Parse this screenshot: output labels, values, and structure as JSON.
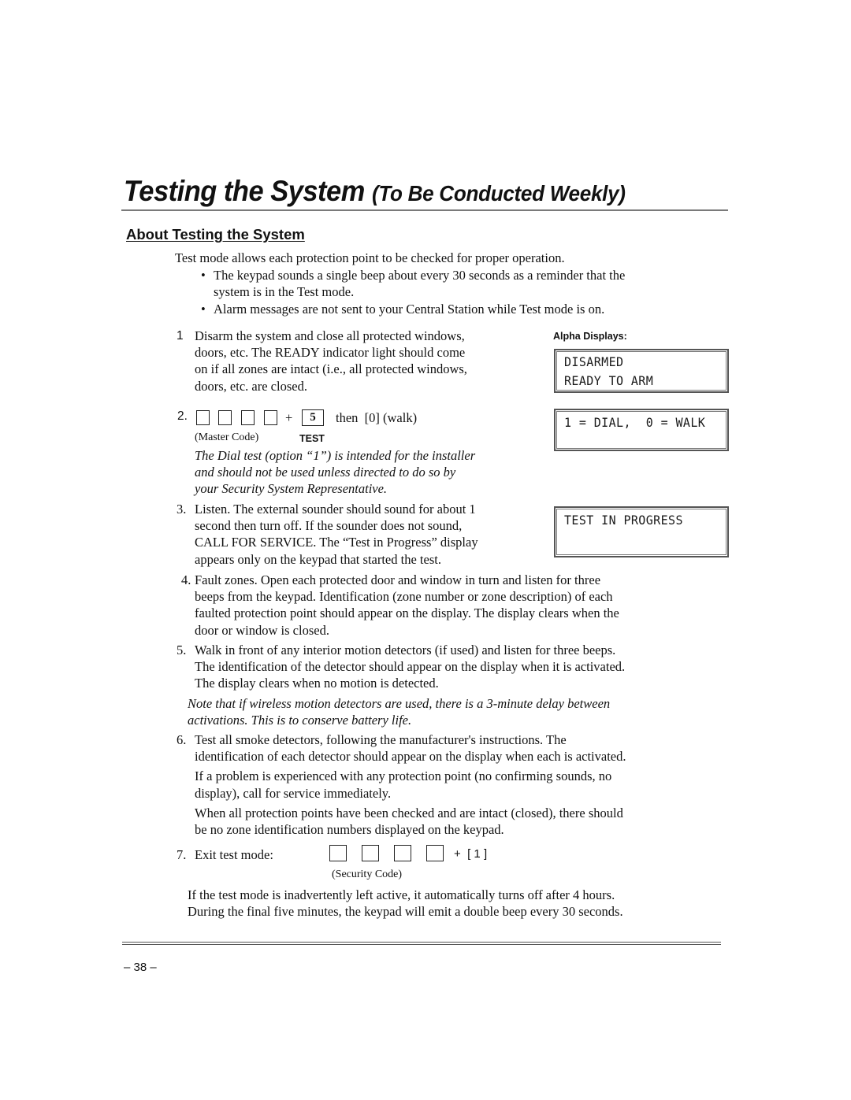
{
  "header": {
    "title_main": "Testing the System",
    "title_sub": "(To Be Conducted Weekly)"
  },
  "section": {
    "heading": "About Testing the System",
    "intro": "Test mode allows each protection point to be checked for proper operation.",
    "bullets": [
      {
        "icon": "bullet-dot",
        "line1": "The keypad sounds a single beep about every 30 seconds as a reminder that the",
        "line2": "system is in the Test mode."
      },
      {
        "icon": "bullet-dot",
        "line1": "Alarm messages are not sent to your Central Station while Test mode is on."
      }
    ]
  },
  "alpha_displays": {
    "label": "Alpha Displays:",
    "displays": [
      {
        "line1": "DISARMED",
        "line2": "READY TO ARM"
      },
      {
        "line1": "1 = DIAL,  0 = WALK",
        "line2": ""
      },
      {
        "line1": "TEST IN PROGRESS",
        "line2": ""
      }
    ]
  },
  "steps": {
    "s1": {
      "num": "1",
      "lines": [
        "Disarm the system and close all protected windows,",
        "doors, etc. The READY indicator light should come",
        "on if all zones are intact (i.e., all protected windows,",
        "doors, etc. are closed."
      ]
    },
    "s2": {
      "num": "2.",
      "plus": "+",
      "test_key": "5",
      "then_text": "then  [0] (walk)",
      "code_label": "(Master Code)",
      "test_label": "TEST",
      "note_lines": [
        "The Dial test (option “1”) is intended for the installer",
        "and should not be used unless directed to do so by",
        "your Security System Representative."
      ]
    },
    "s3": {
      "num": "3.",
      "lines": [
        "Listen. The external sounder should sound for about 1",
        "second then turn off. If the sounder does not sound,",
        "CALL FOR SERVICE. The “Test in Progress” display",
        "appears only on the keypad that started the test."
      ]
    },
    "s4": {
      "num": "4.",
      "lines": [
        "Fault zones. Open each protected door and window in turn and listen for three",
        "beeps from the keypad. Identification (zone number or zone description) of each",
        "faulted protection point should appear on the display. The display clears when the",
        "door or window is closed."
      ]
    },
    "s5": {
      "num": "5.",
      "lines": [
        "Walk in front of any interior motion detectors (if used) and listen for three beeps.",
        "The identification of the detector should appear on the display when it is activated.",
        "The display clears when no motion is detected."
      ],
      "note_lines": [
        "Note that if wireless motion detectors are used, there is a 3-minute delay between",
        "activations. This is to conserve battery life."
      ]
    },
    "s6": {
      "num": "6.",
      "lines": [
        "Test all smoke detectors, following the manufacturer's instructions. The",
        "identification of each detector should appear on the display when each is activated."
      ],
      "para2": [
        "If a problem is experienced with any protection point (no confirming sounds, no",
        "display), call for service immediately."
      ],
      "para3": [
        "When all protection points have been checked and are intact (closed), there should",
        "be no zone identification numbers displayed on the keypad."
      ]
    },
    "s7": {
      "num": "7.",
      "label": "Exit test mode:",
      "plus_key": "+  [ 1 ]",
      "code_label": "(Security Code)",
      "after": [
        "If the test mode is inadvertently left active, it automatically turns off after 4 hours.",
        "During the final five minutes, the keypad will emit a double beep every 30 seconds."
      ]
    }
  },
  "footer": {
    "page_number": "– 38 –"
  }
}
